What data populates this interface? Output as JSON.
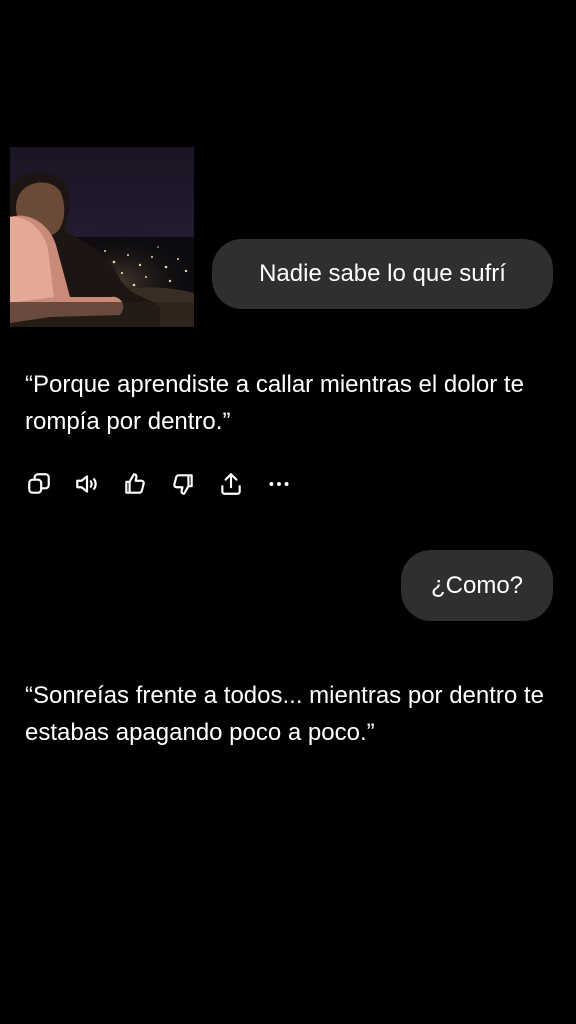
{
  "conversation": {
    "messages": [
      {
        "role": "user",
        "has_image": true,
        "text": "Nadie sabe lo que sufrí"
      },
      {
        "role": "assistant",
        "text": "“Porque aprendiste a callar mientras el dolor te rompía por dentro.”",
        "actions": [
          {
            "icon": "copy-icon"
          },
          {
            "icon": "speaker-icon"
          },
          {
            "icon": "thumbs-up-icon"
          },
          {
            "icon": "thumbs-down-icon"
          },
          {
            "icon": "share-icon"
          },
          {
            "icon": "more-icon"
          }
        ]
      },
      {
        "role": "user",
        "text": "¿Como?"
      },
      {
        "role": "assistant",
        "text": "“Sonreías frente a todos... mientras por dentro te estabas apagando poco a poco.”"
      }
    ]
  },
  "colors": {
    "background": "#000000",
    "user_bubble": "#2f2f2f",
    "text": "#ffffff"
  }
}
